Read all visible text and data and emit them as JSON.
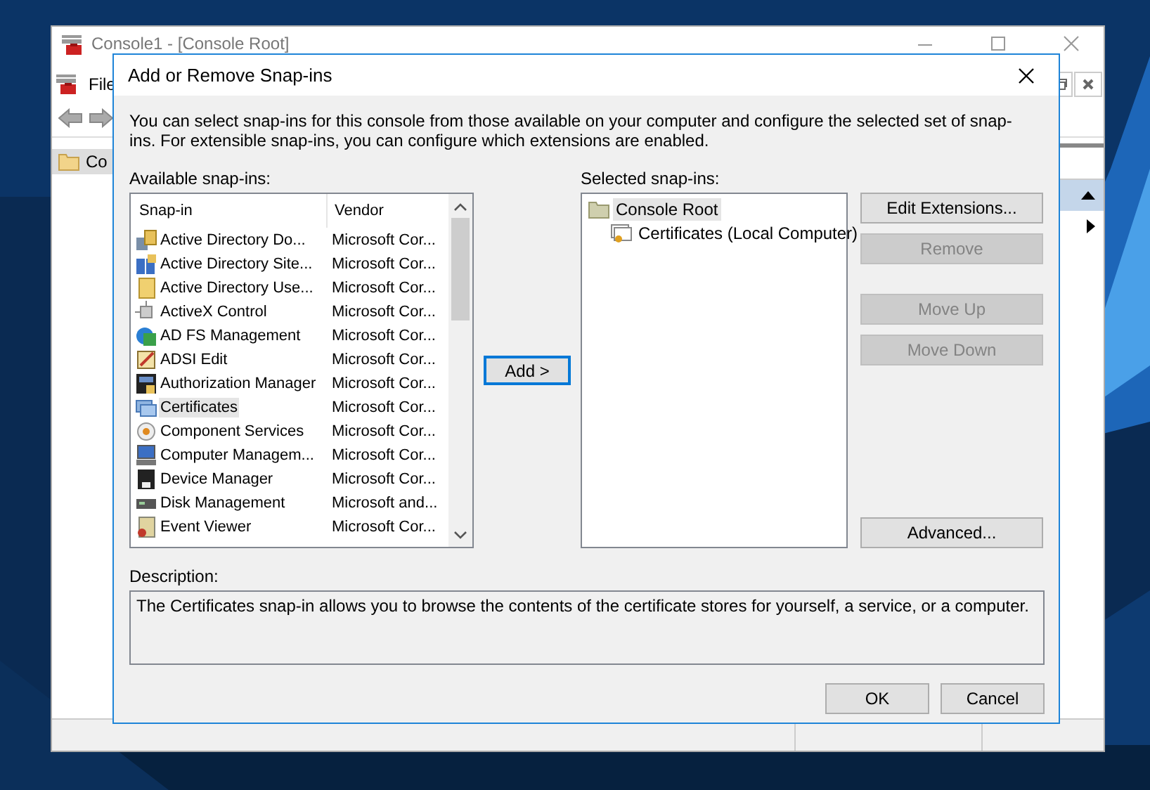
{
  "console_window": {
    "title": "Console1 - [Console Root]",
    "menu": [
      {
        "label": "File"
      }
    ],
    "tree": [
      {
        "label": "Co",
        "selected": true
      }
    ]
  },
  "dialog": {
    "title": "Add or Remove Snap-ins",
    "intro": "You can select snap-ins for this console from those available on your computer and configure the selected set of snap-ins. For extensible snap-ins, you can configure which extensions are enabled.",
    "available_label": "Available snap-ins:",
    "available_table": {
      "columns": [
        "Snap-in",
        "Vendor"
      ],
      "rows": [
        {
          "name": "Active Directory Do...",
          "vendor": "Microsoft Cor...",
          "selected": false
        },
        {
          "name": "Active Directory Site...",
          "vendor": "Microsoft Cor...",
          "selected": false
        },
        {
          "name": "Active Directory Use...",
          "vendor": "Microsoft Cor...",
          "selected": false
        },
        {
          "name": "ActiveX Control",
          "vendor": "Microsoft Cor...",
          "selected": false
        },
        {
          "name": "AD FS Management",
          "vendor": "Microsoft Cor...",
          "selected": false
        },
        {
          "name": "ADSI Edit",
          "vendor": "Microsoft Cor...",
          "selected": false
        },
        {
          "name": "Authorization Manager",
          "vendor": "Microsoft Cor...",
          "selected": false
        },
        {
          "name": "Certificates",
          "vendor": "Microsoft Cor...",
          "selected": true
        },
        {
          "name": "Component Services",
          "vendor": "Microsoft Cor...",
          "selected": false
        },
        {
          "name": "Computer Managem...",
          "vendor": "Microsoft Cor...",
          "selected": false
        },
        {
          "name": "Device Manager",
          "vendor": "Microsoft Cor...",
          "selected": false
        },
        {
          "name": "Disk Management",
          "vendor": "Microsoft and...",
          "selected": false
        },
        {
          "name": "Event Viewer",
          "vendor": "Microsoft Cor...",
          "selected": false
        }
      ]
    },
    "add_button": {
      "label": "Add >",
      "focused": true
    },
    "selected_label": "Selected snap-ins:",
    "selected_tree": [
      {
        "label": "Console Root",
        "selected": true,
        "children": [
          {
            "label": "Certificates (Local Computer)",
            "selected": false
          }
        ]
      }
    ],
    "button_groups": [
      [
        {
          "label": "Edit Extensions...",
          "disabled": false
        },
        {
          "label": "Remove",
          "disabled": true
        }
      ],
      [
        {
          "label": "Move Up",
          "disabled": true
        },
        {
          "label": "Move Down",
          "disabled": true
        }
      ],
      [
        {
          "label": "Advanced...",
          "disabled": false
        }
      ]
    ],
    "description_label": "Description:",
    "description": "The Certificates snap-in allows you to browse the contents of the certificate stores for yourself, a service, or a computer.",
    "buttons": [
      {
        "label": "OK"
      },
      {
        "label": "Cancel"
      }
    ]
  }
}
